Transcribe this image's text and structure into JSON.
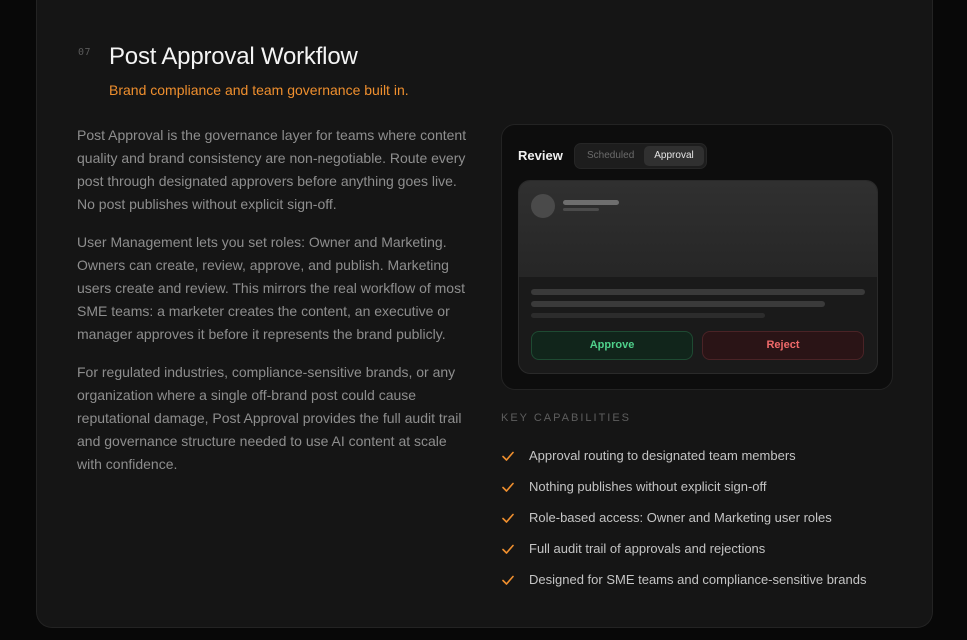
{
  "section": {
    "number": "07",
    "title": "Post Approval Workflow",
    "subtitle": "Brand compliance and team governance built in."
  },
  "description": [
    "Post Approval is the governance layer for teams where content quality and brand consistency are non-negotiable. Route every post through designated approvers before anything goes live. No post publishes without explicit sign-off.",
    "User Management lets you set roles: Owner and Marketing. Owners can create, review, approve, and publish. Marketing users create and review. This mirrors the real workflow of most SME teams: a marketer creates the content, an executive or manager approves it before it represents the brand publicly.",
    "For regulated industries, compliance-sensitive brands, or any organization where a single off-brand post could cause reputational damage, Post Approval provides the full audit trail and governance structure needed to use AI content at scale with confidence."
  ],
  "preview": {
    "label": "Review",
    "tabs": [
      {
        "label": "Scheduled",
        "active": false
      },
      {
        "label": "Approval",
        "active": true
      }
    ],
    "approve_label": "Approve",
    "reject_label": "Reject"
  },
  "capabilities": {
    "heading": "KEY CAPABILITIES",
    "items": [
      "Approval routing to designated team members",
      "Nothing publishes without explicit sign-off",
      "Role-based access: Owner and Marketing user roles",
      "Full audit trail of approvals and rejections",
      "Designed for SME teams and compliance-sensitive brands"
    ]
  },
  "colors": {
    "accent": "#ef8f2e",
    "approve": "#4fd18b",
    "reject": "#f06a6a",
    "background": "#151515"
  },
  "icons": {
    "check": "check-icon"
  }
}
